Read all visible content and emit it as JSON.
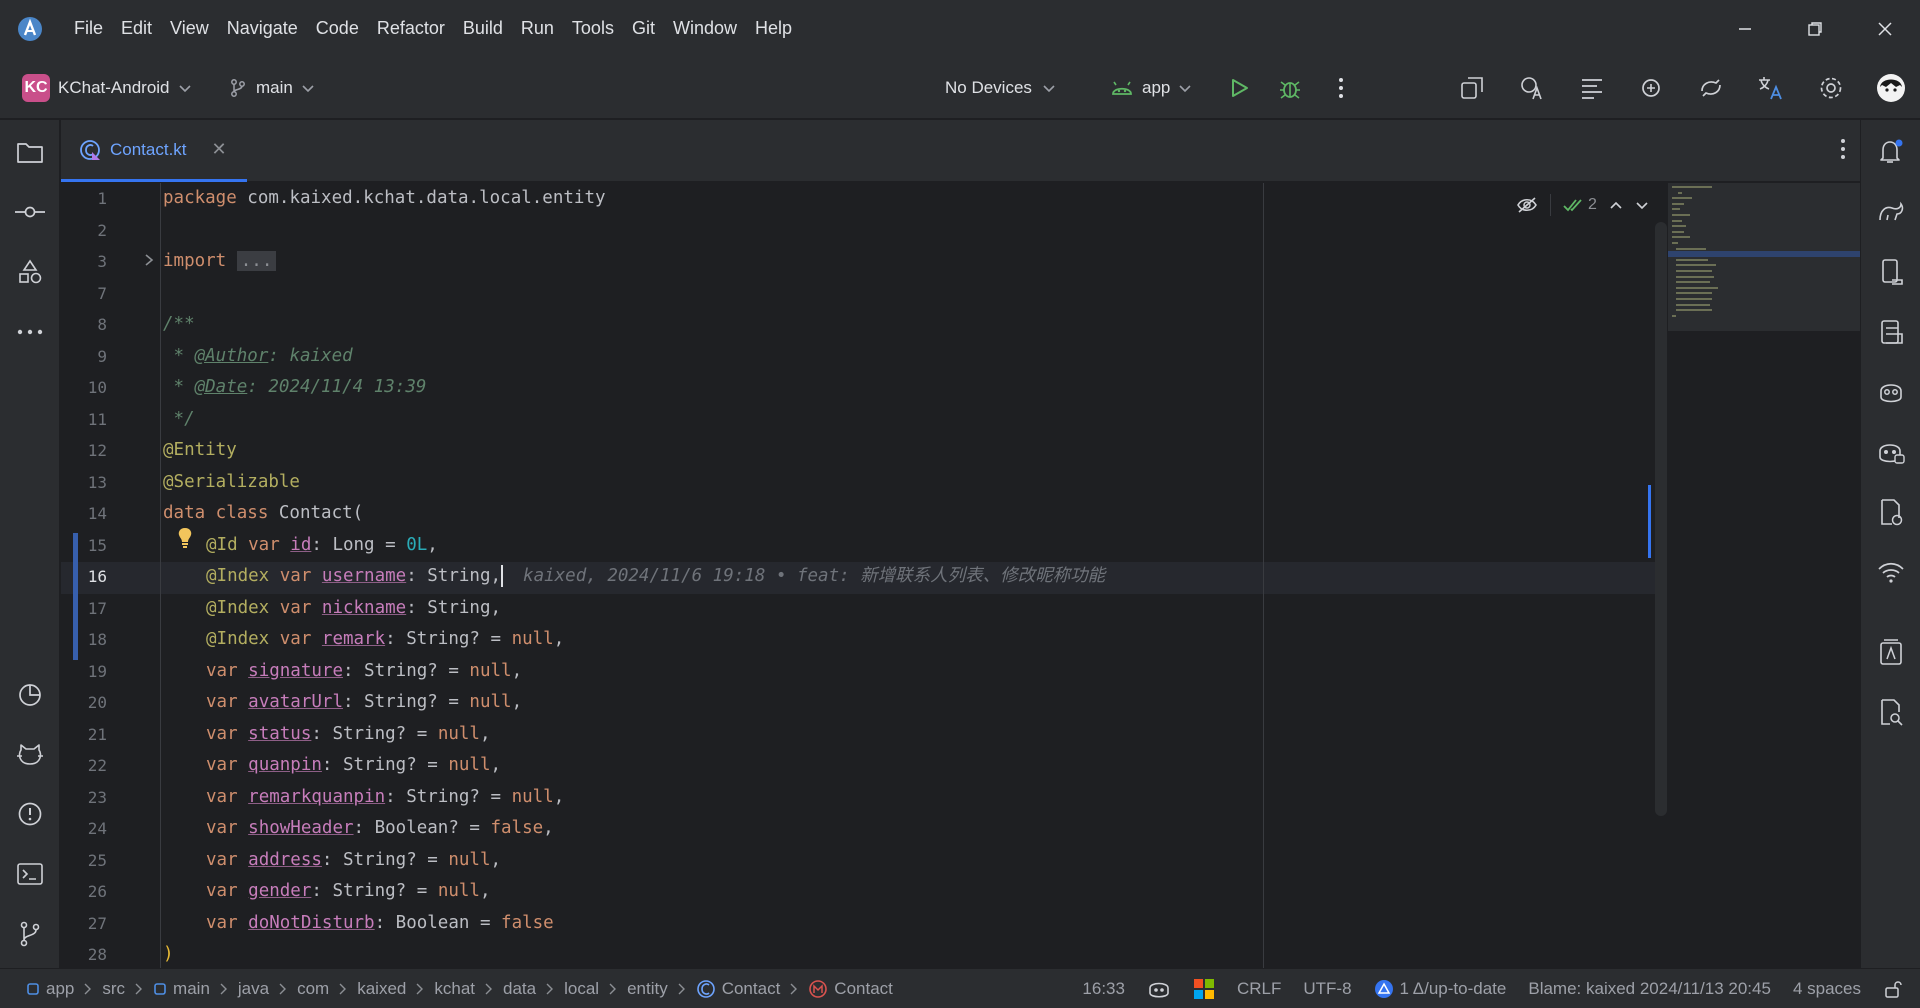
{
  "menu": [
    "File",
    "Edit",
    "View",
    "Navigate",
    "Code",
    "Refactor",
    "Build",
    "Run",
    "Tools",
    "Git",
    "Window",
    "Help"
  ],
  "toolbar": {
    "project_badge": "KC",
    "project_name": "KChat-Android",
    "branch": "main",
    "device": "No Devices",
    "run_config": "app"
  },
  "tab": {
    "label": "Contact.kt",
    "close": "✕"
  },
  "inspection": {
    "count": "2"
  },
  "editor": {
    "line_numbers": [
      "1",
      "2",
      "3",
      "7",
      "8",
      "9",
      "10",
      "11",
      "12",
      "13",
      "14",
      "15",
      "16",
      "17",
      "18",
      "19",
      "20",
      "21",
      "22",
      "23",
      "24",
      "25",
      "26",
      "27",
      "28"
    ],
    "current_line": "16",
    "code": {
      "l1_kw": "package",
      "l1_rest": " com.kaixed.kchat.data.local.entity",
      "l3_kw": "import",
      "l3_fold": "...",
      "l8": "/**",
      "l9_pre": " * ",
      "l9_tag": "@Author",
      "l9_rest": ": kaixed",
      "l10_pre": " * ",
      "l10_tag": "@Date",
      "l10_rest": ": 2024/11/4 13:39",
      "l11": " */",
      "l12": "@Entity",
      "l13": "@Serializable",
      "l14_kw": "data class",
      "l14_rest": " Contact(",
      "l15_ann": "@Id",
      "l15_kw": " var ",
      "l15_prop": "id",
      "l15_mid": ": Long = ",
      "l15_num": "0L",
      "l15_end": ",",
      "l16_ann": "@Index",
      "l16_kw": " var ",
      "l16_prop": "username",
      "l16_rest": ": String,",
      "l16_blame": "kaixed, 2024/11/6 19:18 • feat: 新增联系人列表、修改昵称功能",
      "l17_ann": "@Index",
      "l17_kw": " var ",
      "l17_prop": "nickname",
      "l17_rest": ": String,",
      "l18_ann": "@Index",
      "l18_kw": " var ",
      "l18_prop": "remark",
      "l18_mid": ": String? = ",
      "l18_null": "null",
      "l18_end": ",",
      "fields": [
        {
          "name": "signature",
          "type": ": String? = ",
          "value": "null",
          "end": ","
        },
        {
          "name": "avatarUrl",
          "type": ": String? = ",
          "value": "null",
          "end": ","
        },
        {
          "name": "status",
          "type": ": String? = ",
          "value": "null",
          "end": ","
        },
        {
          "name": "quanpin",
          "type": ": String? = ",
          "value": "null",
          "end": ","
        },
        {
          "name": "remarkquanpin",
          "type": ": String? = ",
          "value": "null",
          "end": ","
        },
        {
          "name": "showHeader",
          "type": ": Boolean? = ",
          "value": "false",
          "end": ","
        },
        {
          "name": "address",
          "type": ": String? = ",
          "value": "null",
          "end": ","
        },
        {
          "name": "gender",
          "type": ": String? = ",
          "value": "null",
          "end": ","
        },
        {
          "name": "doNotDisturb",
          "type": ": Boolean = ",
          "value": "false",
          "end": ""
        }
      ],
      "var_kw": "var ",
      "l28": ")"
    }
  },
  "statusbar": {
    "breadcrumbs": [
      "app",
      "src",
      "main",
      "java",
      "com",
      "kaixed",
      "kchat",
      "data",
      "local",
      "entity",
      "Contact",
      "Contact"
    ],
    "position": "16:33",
    "line_sep": "CRLF",
    "encoding": "UTF-8",
    "vcs": "1 Δ/up-to-date",
    "blame": "Blame: kaixed 2024/11/13 20:45",
    "indent": "4 spaces"
  },
  "colors": {
    "accent": "#3574f0",
    "keyword": "#cf8e6d",
    "annotation": "#b3ae60",
    "number": "#2aacb8",
    "property": "#c77dbb",
    "doc": "#5f826b"
  }
}
